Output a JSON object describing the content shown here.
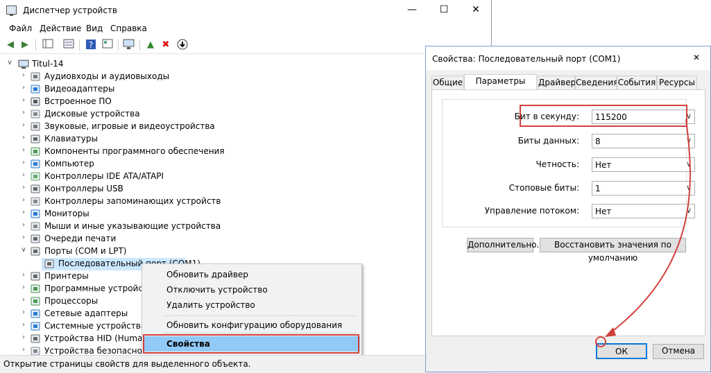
{
  "device_manager": {
    "title": "Диспетчер устройств",
    "menu": [
      "Файл",
      "Действие",
      "Вид",
      "Справка"
    ],
    "root": "Titul-14",
    "categories": [
      {
        "label": "Аудиовходы и аудиовыходы",
        "icon": "speaker-icon"
      },
      {
        "label": "Видеоадаптеры",
        "icon": "display-adapter-icon"
      },
      {
        "label": "Встроенное ПО",
        "icon": "firmware-icon"
      },
      {
        "label": "Дисковые устройства",
        "icon": "disk-drive-icon"
      },
      {
        "label": "Звуковые, игровые и видеоустройства",
        "icon": "sound-icon"
      },
      {
        "label": "Клавиатуры",
        "icon": "keyboard-icon"
      },
      {
        "label": "Компоненты программного обеспечения",
        "icon": "software-component-icon"
      },
      {
        "label": "Компьютер",
        "icon": "computer-icon"
      },
      {
        "label": "Контроллеры IDE ATA/ATAPI",
        "icon": "ide-controller-icon"
      },
      {
        "label": "Контроллеры USB",
        "icon": "usb-icon"
      },
      {
        "label": "Контроллеры запоминающих устройств",
        "icon": "storage-controller-icon"
      },
      {
        "label": "Мониторы",
        "icon": "monitor-icon"
      },
      {
        "label": "Мыши и иные указывающие устройства",
        "icon": "mouse-icon"
      },
      {
        "label": "Очереди печати",
        "icon": "print-queue-icon"
      },
      {
        "label": "Порты (COM и LPT)",
        "icon": "port-icon",
        "expanded": true
      },
      {
        "label": "Последовательный порт (COM1)",
        "icon": "port-icon",
        "child": true
      },
      {
        "label": "Принтеры",
        "icon": "printer-icon"
      },
      {
        "label": "Программные устройства",
        "icon": "software-device-icon"
      },
      {
        "label": "Процессоры",
        "icon": "processor-icon"
      },
      {
        "label": "Сетевые адаптеры",
        "icon": "network-adapter-icon"
      },
      {
        "label": "Системные устройства",
        "icon": "system-device-icon"
      },
      {
        "label": "Устройства HID (Human Interface Devices)",
        "icon": "hid-icon"
      },
      {
        "label": "Устройства безопасности",
        "icon": "security-device-icon"
      }
    ],
    "context_menu": {
      "update_driver": "Обновить драйвер",
      "disable_device": "Отключить устройство",
      "uninstall_device": "Удалить устройство",
      "scan_hardware": "Обновить конфигурацию оборудования",
      "properties": "Свойства"
    },
    "status_text": "Открытие страницы свойств для выделенного объекта."
  },
  "properties_dialog": {
    "title": "Свойства: Последовательный порт (COM1)",
    "tabs": [
      "Общие",
      "Параметры порта",
      "Драйвер",
      "Сведения",
      "События",
      "Ресурсы"
    ],
    "active_tab": "Параметры порта",
    "fields": {
      "baud_label": "Бит в секунду:",
      "baud_value": "115200",
      "data_bits_label": "Биты данных:",
      "data_bits_value": "8",
      "parity_label": "Четность:",
      "parity_value": "Нет",
      "stop_bits_label": "Стоповые биты:",
      "stop_bits_value": "1",
      "flow_label": "Управление потоком:",
      "flow_value": "Нет"
    },
    "advanced_button": "Дополнительно...",
    "restore_button": "Восстановить значения по умолчанию",
    "ok_button": "ОК",
    "cancel_button": "Отмена"
  },
  "colors": {
    "highlight": "#91c9f7",
    "selection": "#cce8ff",
    "annotation_red": "#d2403c"
  }
}
